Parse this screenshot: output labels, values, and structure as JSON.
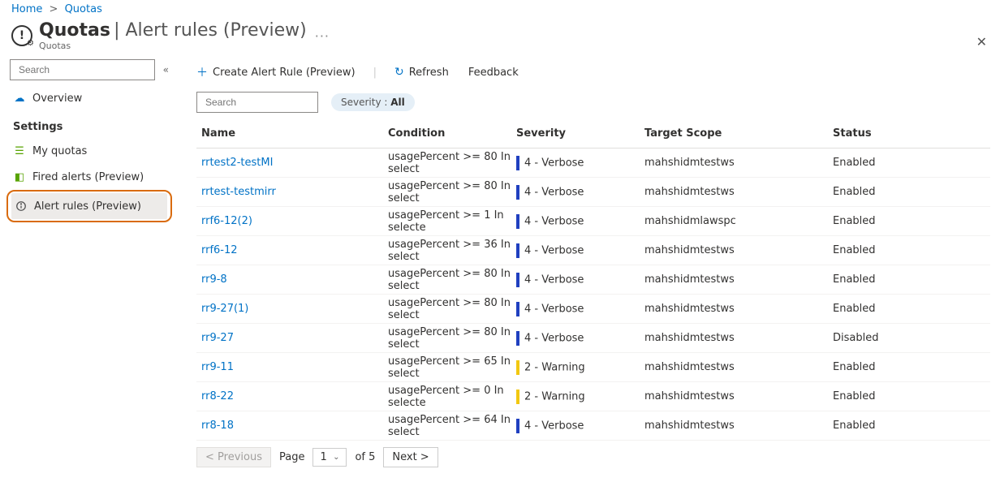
{
  "breadcrumb": {
    "home": "Home",
    "quotas": "Quotas"
  },
  "header": {
    "title": "Quotas",
    "section": "Alert rules (Preview)",
    "subtitle": "Quotas"
  },
  "sidebar": {
    "search_placeholder": "Search",
    "overview": "Overview",
    "settings_heading": "Settings",
    "my_quotas": "My quotas",
    "fired_alerts": "Fired alerts (Preview)",
    "alert_rules": "Alert rules (Preview)"
  },
  "toolbar": {
    "create": "Create Alert Rule (Preview)",
    "refresh": "Refresh",
    "feedback": "Feedback"
  },
  "filter": {
    "search_placeholder": "Search",
    "severity_label": "Severity : ",
    "severity_value": "All"
  },
  "columns": {
    "name": "Name",
    "condition": "Condition",
    "severity": "Severity",
    "scope": "Target Scope",
    "status": "Status"
  },
  "rows": [
    {
      "name": "rrtest2-testMI",
      "condition": "usagePercent >= 80 In select",
      "severity": "4 - Verbose",
      "sevClass": "sev-verbose",
      "scope": "mahshidmtestws",
      "status": "Enabled"
    },
    {
      "name": "rrtest-testmirr",
      "condition": "usagePercent >= 80 In select",
      "severity": "4 - Verbose",
      "sevClass": "sev-verbose",
      "scope": "mahshidmtestws",
      "status": "Enabled"
    },
    {
      "name": "rrf6-12(2)",
      "condition": "usagePercent >= 1 In selecte",
      "severity": "4 - Verbose",
      "sevClass": "sev-verbose",
      "scope": "mahshidmlawspc",
      "status": "Enabled"
    },
    {
      "name": "rrf6-12",
      "condition": "usagePercent >= 36 In select",
      "severity": "4 - Verbose",
      "sevClass": "sev-verbose",
      "scope": "mahshidmtestws",
      "status": "Enabled"
    },
    {
      "name": "rr9-8",
      "condition": "usagePercent >= 80 In select",
      "severity": "4 - Verbose",
      "sevClass": "sev-verbose",
      "scope": "mahshidmtestws",
      "status": "Enabled"
    },
    {
      "name": "rr9-27(1)",
      "condition": "usagePercent >= 80 In select",
      "severity": "4 - Verbose",
      "sevClass": "sev-verbose",
      "scope": "mahshidmtestws",
      "status": "Enabled"
    },
    {
      "name": "rr9-27",
      "condition": "usagePercent >= 80 In select",
      "severity": "4 - Verbose",
      "sevClass": "sev-verbose",
      "scope": "mahshidmtestws",
      "status": "Disabled"
    },
    {
      "name": "rr9-11",
      "condition": "usagePercent >= 65 In select",
      "severity": "2 - Warning",
      "sevClass": "sev-warning",
      "scope": "mahshidmtestws",
      "status": "Enabled"
    },
    {
      "name": "rr8-22",
      "condition": "usagePercent >= 0 In selecte",
      "severity": "2 - Warning",
      "sevClass": "sev-warning",
      "scope": "mahshidmtestws",
      "status": "Enabled"
    },
    {
      "name": "rr8-18",
      "condition": "usagePercent >= 64 In select",
      "severity": "4 - Verbose",
      "sevClass": "sev-verbose",
      "scope": "mahshidmtestws",
      "status": "Enabled"
    }
  ],
  "pager": {
    "previous": "< Previous",
    "page_label": "Page",
    "current": "1",
    "of": "of 5",
    "next": "Next >"
  }
}
